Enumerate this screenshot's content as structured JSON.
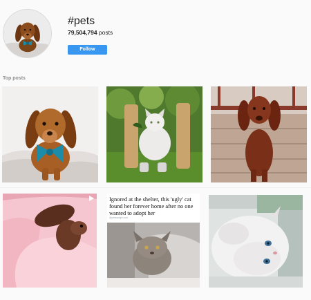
{
  "header": {
    "hashtag": "#pets",
    "posts_count": "79,504,794",
    "posts_label": " posts",
    "follow_label": "Follow",
    "accent_color": "#3897f0"
  },
  "section_title": "Top posts",
  "posts": [
    {
      "subject": "dachshund with teal bow tie"
    },
    {
      "subject": "white cat between wooden posts"
    },
    {
      "subject": "red setter on deck"
    },
    {
      "subject": "squirrel on pink blanket",
      "media": "video-icon"
    },
    {
      "subject": "gray cat on bed",
      "caption": "Ignored at the shelter, this 'ugly' cat found her forever home after no one wanted to adopt her",
      "credit": "@petsadopt.com"
    },
    {
      "subject": "white persian cat"
    }
  ]
}
